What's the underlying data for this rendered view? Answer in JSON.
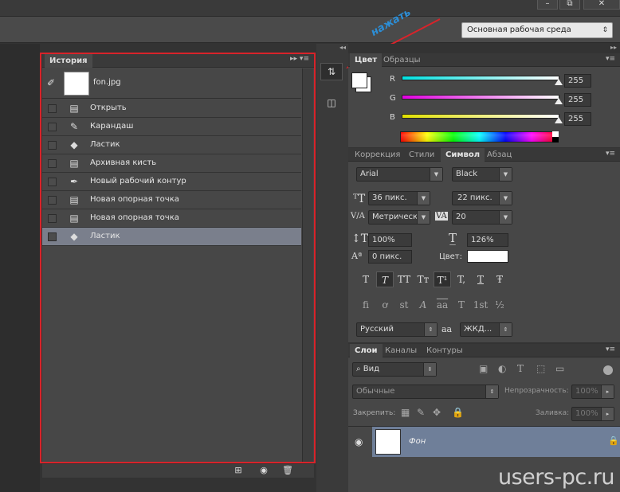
{
  "window": {
    "min_glyph": "–",
    "max_glyph": "⧉",
    "close_glyph": "✕"
  },
  "options_bar": {
    "workspace": "Основная рабочая среда",
    "workspace_arrow": "⇕"
  },
  "annotation": {
    "text": "нажать"
  },
  "history": {
    "tab": "История",
    "menu": "▸▸ ▾≡",
    "snapshot": "fon.jpg",
    "items": [
      {
        "label": "Открыть",
        "icon": "document-icon",
        "glyph": "▤"
      },
      {
        "label": "Карандаш",
        "icon": "pencil-icon",
        "glyph": "✎"
      },
      {
        "label": "Ластик",
        "icon": "eraser-icon",
        "glyph": "◆"
      },
      {
        "label": "Архивная кисть",
        "icon": "document-icon",
        "glyph": "▤"
      },
      {
        "label": "Новый рабочий контур",
        "icon": "pen-tool-icon",
        "glyph": "✒"
      },
      {
        "label": "Новая опорная точка",
        "icon": "document-icon",
        "glyph": "▤"
      },
      {
        "label": "Новая опорная точка",
        "icon": "document-icon",
        "glyph": "▤"
      },
      {
        "label": "Ластик",
        "icon": "eraser-icon",
        "glyph": "◆"
      }
    ],
    "footer": {
      "new_doc": "⊞",
      "snapshot": "◉",
      "trash": "🗑"
    }
  },
  "color": {
    "tabs": [
      "Цвет",
      "Образцы"
    ],
    "channels": [
      {
        "label": "R",
        "value": "255",
        "color": "#00e0e0"
      },
      {
        "label": "G",
        "value": "255",
        "color": "#e000e0"
      },
      {
        "label": "B",
        "value": "255",
        "color": "#e0e000"
      }
    ]
  },
  "character": {
    "tabs": [
      "Коррекция",
      "Стили",
      "Символ",
      "Абзац"
    ],
    "font_family": "Arial",
    "font_style": "Black",
    "font_size": "36 пикс.",
    "leading": "22 пикс.",
    "kerning": "Метрическ",
    "tracking": "20",
    "vscale": "100%",
    "hscale": "126%",
    "baseline": "0 пикс.",
    "color_label": "Цвет:",
    "style_buttons": [
      "T",
      "T",
      "TT",
      "Tт",
      "T¹",
      "T,",
      "T",
      "Ŧ"
    ],
    "ot_buttons": [
      "fi",
      "ơ",
      "st",
      "A",
      "aa",
      "T",
      "1st",
      "½"
    ],
    "language": "Русский",
    "aa_label": "aa",
    "antialias": "ЖКД..."
  },
  "layers": {
    "tabs": [
      "Слои",
      "Каналы",
      "Контуры"
    ],
    "filter": "Вид",
    "blend": "Обычные",
    "opacity_label": "Непрозрачность:",
    "opacity": "100%",
    "lock_label": "Закрепить:",
    "fill_label": "Заливка:",
    "fill": "100%",
    "layer_name": "Фон"
  },
  "watermark": "users-pc.ru"
}
